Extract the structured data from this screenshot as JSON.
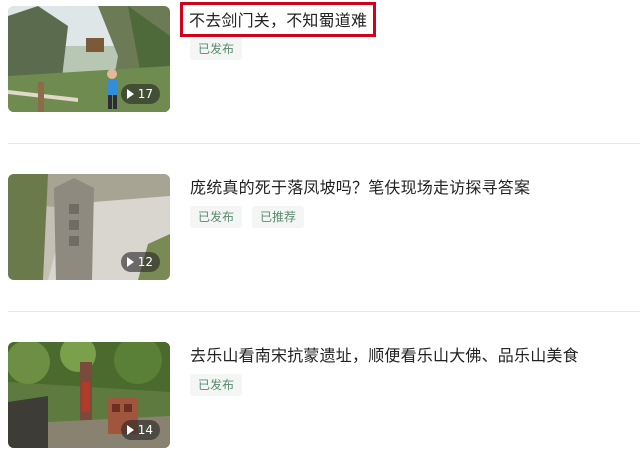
{
  "videos": [
    {
      "title": "不去剑门关，不知蜀道难",
      "count": "17",
      "tags": [
        "已发布"
      ],
      "highlighted": true
    },
    {
      "title": "庞统真的死于落凤坡吗？笔伕现场走访探寻答案",
      "count": "12",
      "tags": [
        "已发布",
        "已推荐"
      ],
      "highlighted": false
    },
    {
      "title": "去乐山看南宋抗蒙遗址，顺便看乐山大佛、品乐山美食",
      "count": "14",
      "tags": [
        "已发布"
      ],
      "highlighted": false
    }
  ],
  "colors": {
    "highlight_border": "#d0021b",
    "tag_text": "#5a8a6e",
    "tag_bg": "#f3f6f4"
  }
}
